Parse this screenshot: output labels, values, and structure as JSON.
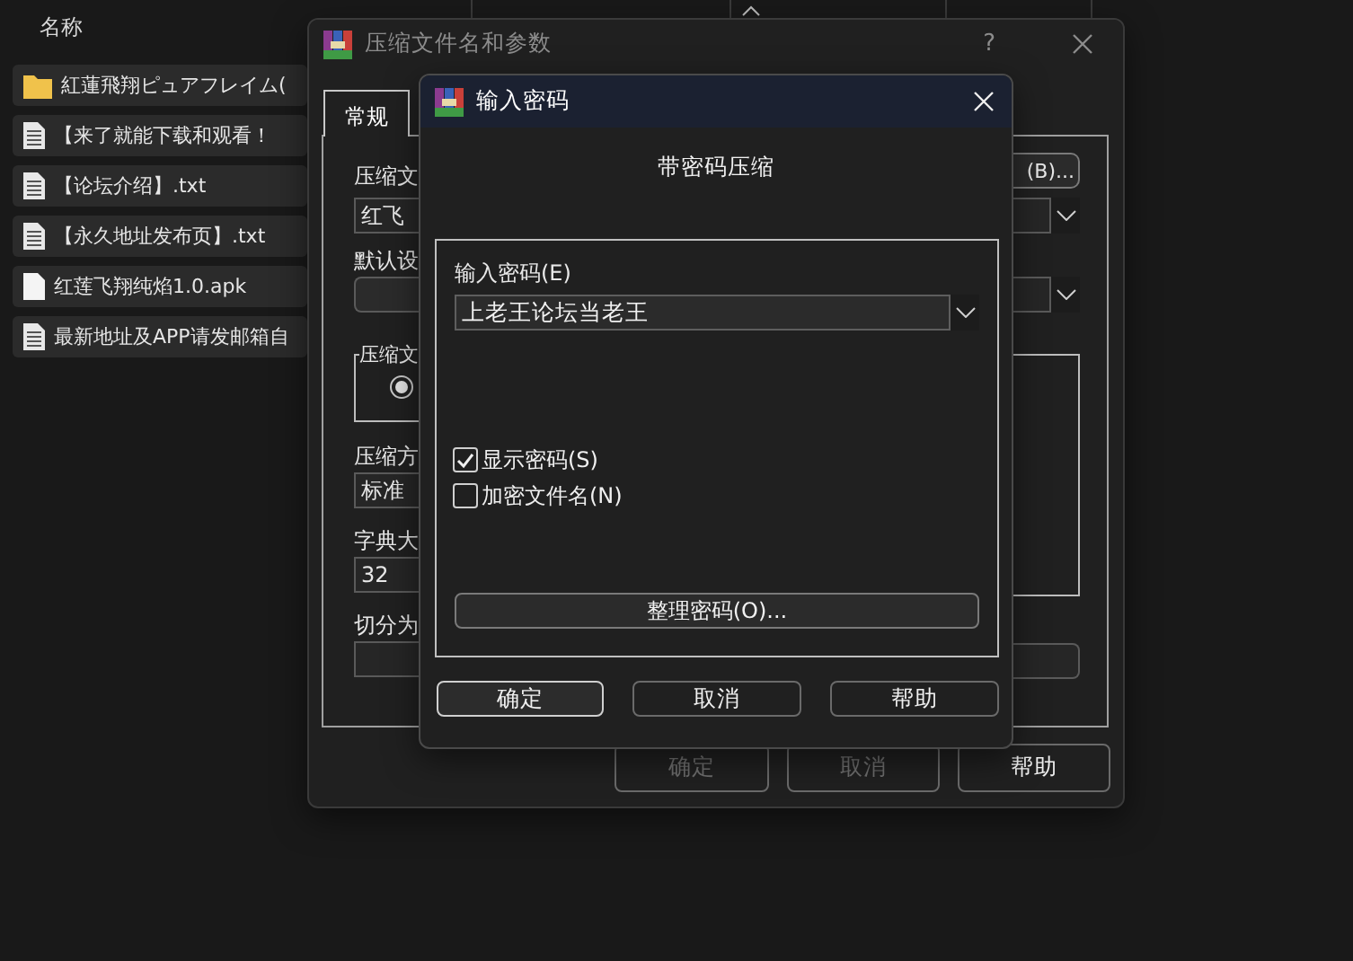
{
  "explorer": {
    "column_header": "名称",
    "items": [
      {
        "kind": "folder",
        "name": "紅蓮飛翔ピュアフレイム("
      },
      {
        "kind": "text",
        "name": "【来了就能下载和观看！"
      },
      {
        "kind": "text",
        "name": "【论坛介绍】.txt"
      },
      {
        "kind": "text",
        "name": "【永久地址发布页】.txt"
      },
      {
        "kind": "file",
        "name": "红莲飞翔纯焰1.0.apk"
      },
      {
        "kind": "text",
        "name": "最新地址及APP请发邮箱自"
      }
    ]
  },
  "archive_dialog": {
    "title": "压缩文件名和参数",
    "help": "?",
    "tabs": [
      {
        "label": "常规",
        "selected": true
      }
    ],
    "archive_name_label": "压缩文",
    "archive_name_value": "红飞",
    "browse_button": "(B)...",
    "profile_label": "默认设",
    "format_group_label": "压缩文",
    "format_radio": {
      "selected": true
    },
    "method_label": "压缩方",
    "method_value": "标准",
    "dictionary_label": "字典大",
    "dictionary_value": "32",
    "split_label": "切分为",
    "buttons": [
      {
        "label": "确定",
        "disabled": true
      },
      {
        "label": "取消",
        "disabled": true
      },
      {
        "label": "帮助",
        "disabled": false
      }
    ]
  },
  "password_dialog": {
    "title": "输入密码",
    "heading": "带密码压缩",
    "password_label": "输入密码(E)",
    "password_value": "上老王论坛当老王",
    "options": [
      {
        "label": "显示密码(S)",
        "checked": true
      },
      {
        "label": "加密文件名(N)",
        "checked": false
      }
    ],
    "organize_button": "整理密码(O)...",
    "buttons": [
      {
        "label": "确定",
        "default": true
      },
      {
        "label": "取消",
        "default": false
      },
      {
        "label": "帮助",
        "default": false
      }
    ]
  }
}
